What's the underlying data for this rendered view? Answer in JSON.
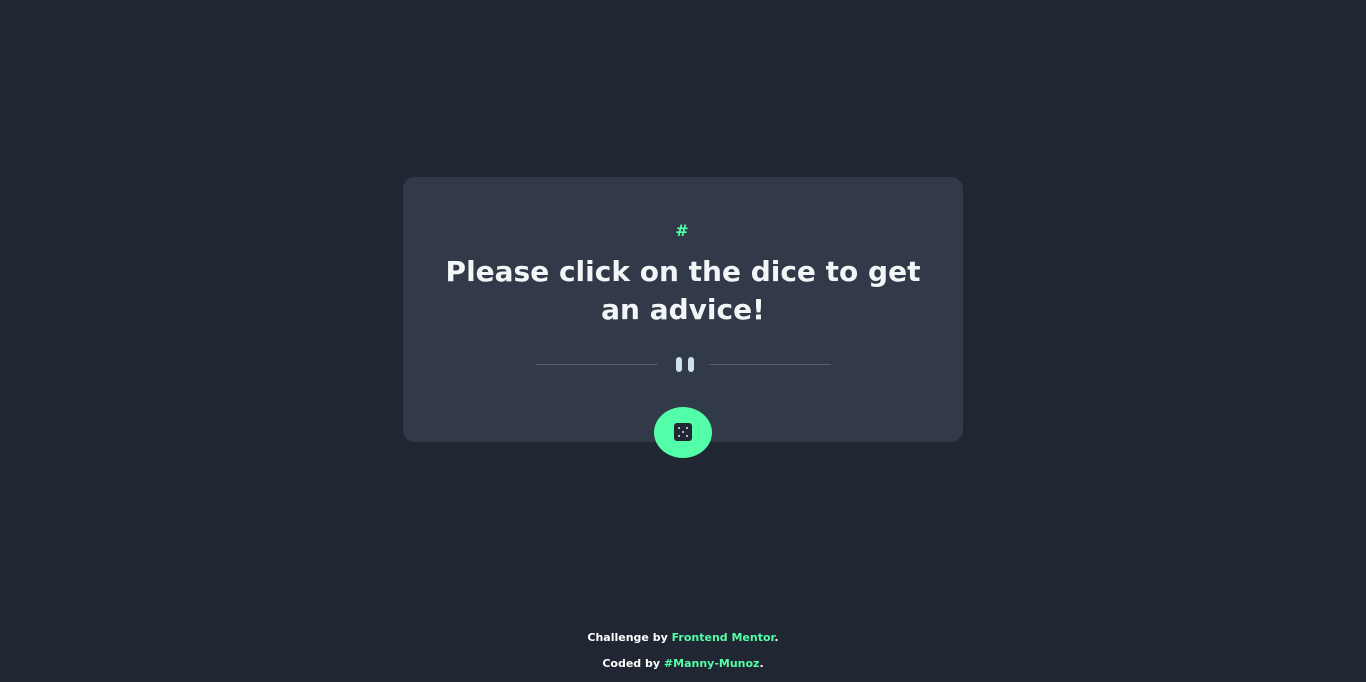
{
  "card": {
    "advice_id": "#",
    "advice_text": "Please click on the dice to get an advice!"
  },
  "dice_button": {
    "icon": "dice-icon"
  },
  "footer": {
    "challenge_prefix": "Challenge by",
    "challenge_link": "Frontend Mentor",
    "challenge_suffix": ".",
    "coded_prefix": "Coded by",
    "coded_link": "#Manny-Munoz",
    "coded_suffix": "."
  },
  "colors": {
    "background": "#202632",
    "card": "#323a4a",
    "accent": "#52ffa8",
    "text": "#f2f6f7",
    "divider": "#4f5d74"
  }
}
